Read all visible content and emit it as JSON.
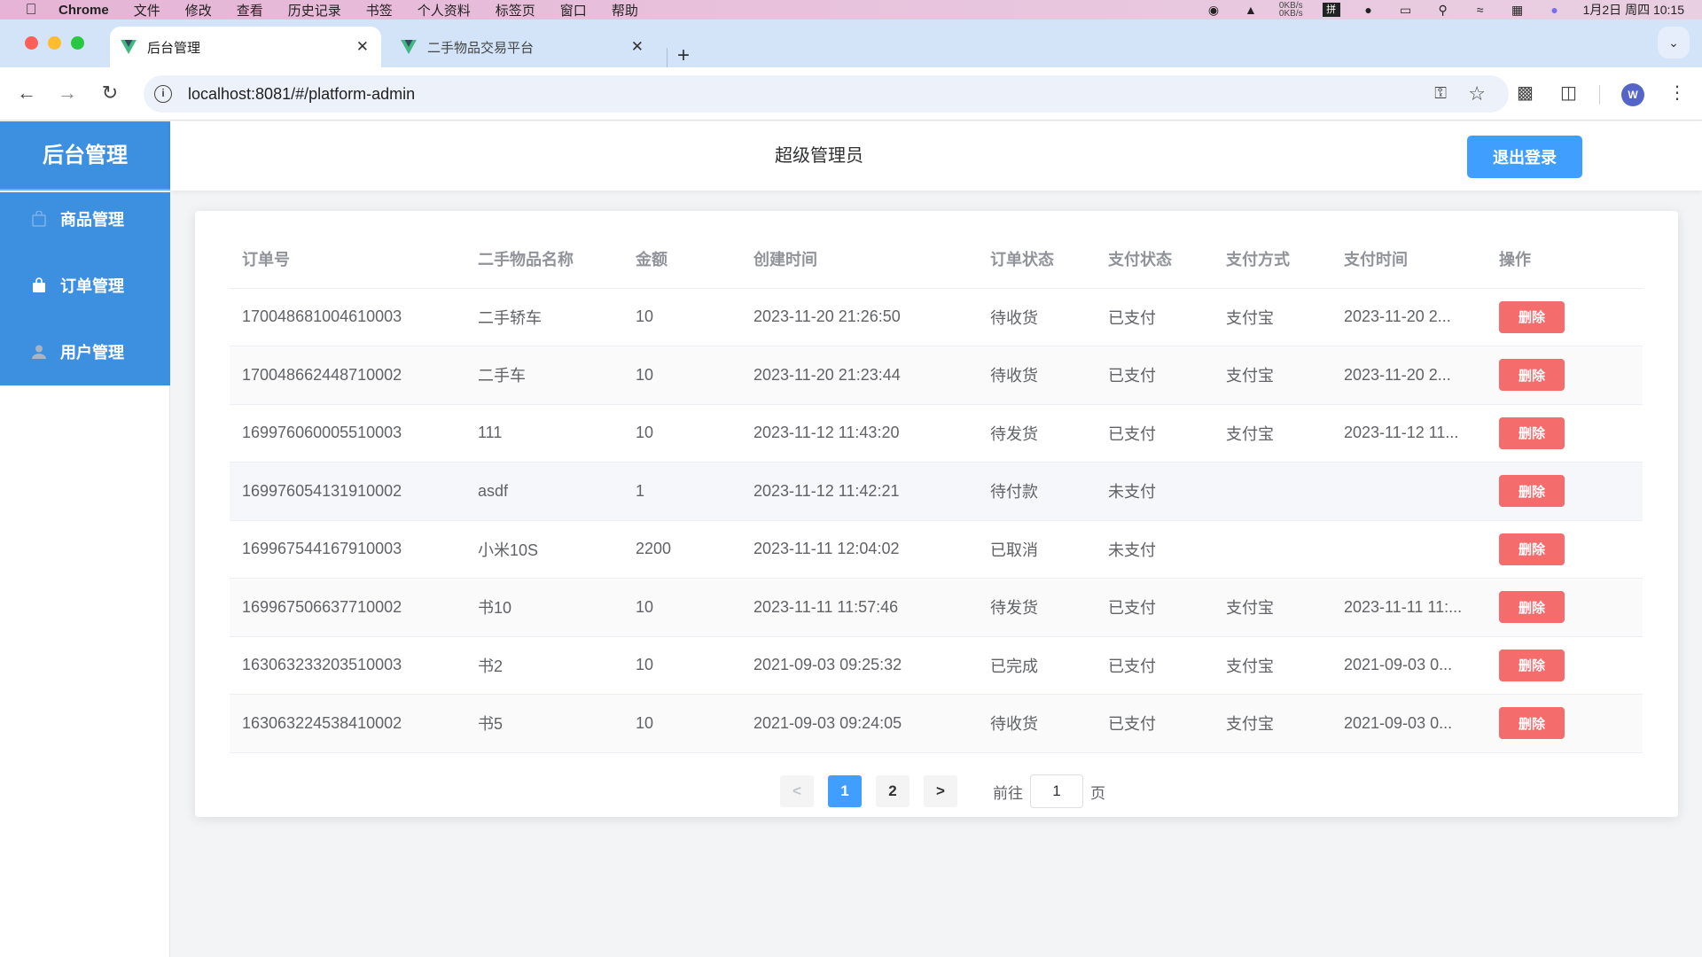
{
  "menubar": {
    "app_name": "Chrome",
    "items": [
      "文件",
      "修改",
      "查看",
      "历史记录",
      "书签",
      "个人资料",
      "标签页",
      "窗口",
      "帮助"
    ],
    "net_up": "0KB/s",
    "net_down": "0KB/s",
    "ime": "拼",
    "datetime": "1月2日 周四 10:15"
  },
  "browser": {
    "tabs": [
      {
        "title": "后台管理",
        "active": true
      },
      {
        "title": "二手物品交易平台",
        "active": false
      }
    ],
    "url": "localhost:8081/#/platform-admin",
    "profile_initial": "W",
    "accent": "#409eff"
  },
  "sidebar": {
    "logo": "后台管理",
    "items": [
      {
        "label": "商品管理",
        "icon": "goods-icon"
      },
      {
        "label": "订单管理",
        "icon": "bag-icon"
      },
      {
        "label": "用户管理",
        "icon": "user-icon"
      }
    ]
  },
  "header": {
    "title": "超级管理员",
    "logout_label": "退出登录"
  },
  "table": {
    "columns": [
      "订单号",
      "二手物品名称",
      "金额",
      "创建时间",
      "订单状态",
      "支付状态",
      "支付方式",
      "支付时间",
      "操作"
    ],
    "action_label": "删除",
    "rows": [
      {
        "order_no": "170048681004610003",
        "name": "二手轿车",
        "amount": "10",
        "created": "2023-11-20 21:26:50",
        "order_status": "待收货",
        "pay_status": "已支付",
        "pay_method": "支付宝",
        "pay_time": "2023-11-20 2..."
      },
      {
        "order_no": "170048662448710002",
        "name": "二手车",
        "amount": "10",
        "created": "2023-11-20 21:23:44",
        "order_status": "待收货",
        "pay_status": "已支付",
        "pay_method": "支付宝",
        "pay_time": "2023-11-20 2..."
      },
      {
        "order_no": "169976060005510003",
        "name": "111",
        "amount": "10",
        "created": "2023-11-12 11:43:20",
        "order_status": "待发货",
        "pay_status": "已支付",
        "pay_method": "支付宝",
        "pay_time": "2023-11-12 11..."
      },
      {
        "order_no": "169976054131910002",
        "name": "asdf",
        "amount": "1",
        "created": "2023-11-12 11:42:21",
        "order_status": "待付款",
        "pay_status": "未支付",
        "pay_method": "",
        "pay_time": ""
      },
      {
        "order_no": "169967544167910003",
        "name": "小米10S",
        "amount": "2200",
        "created": "2023-11-11 12:04:02",
        "order_status": "已取消",
        "pay_status": "未支付",
        "pay_method": "",
        "pay_time": ""
      },
      {
        "order_no": "169967506637710002",
        "name": "书10",
        "amount": "10",
        "created": "2023-11-11 11:57:46",
        "order_status": "待发货",
        "pay_status": "已支付",
        "pay_method": "支付宝",
        "pay_time": "2023-11-11 11:..."
      },
      {
        "order_no": "163063233203510003",
        "name": "书2",
        "amount": "10",
        "created": "2021-09-03 09:25:32",
        "order_status": "已完成",
        "pay_status": "已支付",
        "pay_method": "支付宝",
        "pay_time": "2021-09-03 0..."
      },
      {
        "order_no": "163063224538410002",
        "name": "书5",
        "amount": "10",
        "created": "2021-09-03 09:24:05",
        "order_status": "待收货",
        "pay_status": "已支付",
        "pay_method": "支付宝",
        "pay_time": "2021-09-03 0..."
      }
    ]
  },
  "pagination": {
    "prev": "<",
    "pages": [
      "1",
      "2"
    ],
    "current": "1",
    "next": ">",
    "goto_prefix": "前往",
    "goto_value": "1",
    "goto_suffix": "页"
  }
}
